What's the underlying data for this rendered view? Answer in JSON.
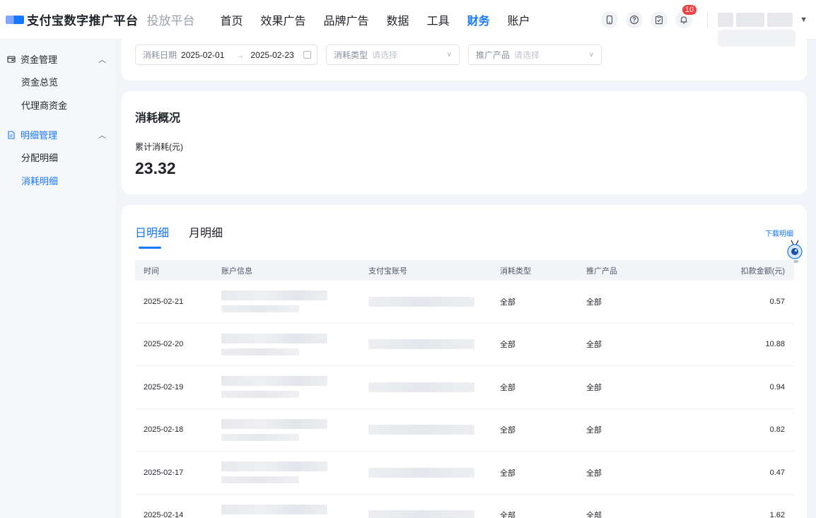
{
  "brand": {
    "title": "支付宝数字推广平台",
    "subtitle": "投放平台"
  },
  "nav": [
    {
      "label": "首页"
    },
    {
      "label": "效果广告"
    },
    {
      "label": "品牌广告"
    },
    {
      "label": "数据"
    },
    {
      "label": "工具"
    },
    {
      "label": "财务",
      "active": true
    },
    {
      "label": "账户"
    }
  ],
  "top_icons": {
    "notification_count": "10"
  },
  "sidebar": {
    "groups": [
      {
        "label": "资金管理",
        "icon": "wallet-icon",
        "items": [
          "资金总览",
          "代理商资金"
        ]
      },
      {
        "label": "明细管理",
        "icon": "document-icon",
        "items": [
          "分配明细",
          "消耗明细"
        ],
        "active_item": "消耗明细"
      }
    ]
  },
  "filters": {
    "date_label": "消耗日期",
    "date_start": "2025-02-01",
    "date_end": "2025-02-23",
    "type_label": "消耗类型",
    "type_placeholder": "请选择",
    "product_label": "推广产品",
    "product_placeholder": "请选择"
  },
  "overview": {
    "title": "消耗概况",
    "label": "累计消耗(元)",
    "value": "23.32"
  },
  "detail": {
    "tabs": [
      "日明细",
      "月明细"
    ],
    "download_label": "下载明细",
    "columns": [
      "时间",
      "账户信息",
      "支付宝账号",
      "消耗类型",
      "推广产品",
      "扣款金额(元)"
    ],
    "rows": [
      {
        "date": "2025-02-21",
        "type": "全部",
        "product": "全部",
        "amount": "0.57"
      },
      {
        "date": "2025-02-20",
        "type": "全部",
        "product": "全部",
        "amount": "10.88"
      },
      {
        "date": "2025-02-19",
        "type": "全部",
        "product": "全部",
        "amount": "0.94"
      },
      {
        "date": "2025-02-18",
        "type": "全部",
        "product": "全部",
        "amount": "0.82"
      },
      {
        "date": "2025-02-17",
        "type": "全部",
        "product": "全部",
        "amount": "0.47"
      },
      {
        "date": "2025-02-14",
        "type": "全部",
        "product": "全部",
        "amount": "1.62"
      }
    ]
  },
  "colors": {
    "accent": "#1677ff",
    "badge": "#f53f3f"
  }
}
